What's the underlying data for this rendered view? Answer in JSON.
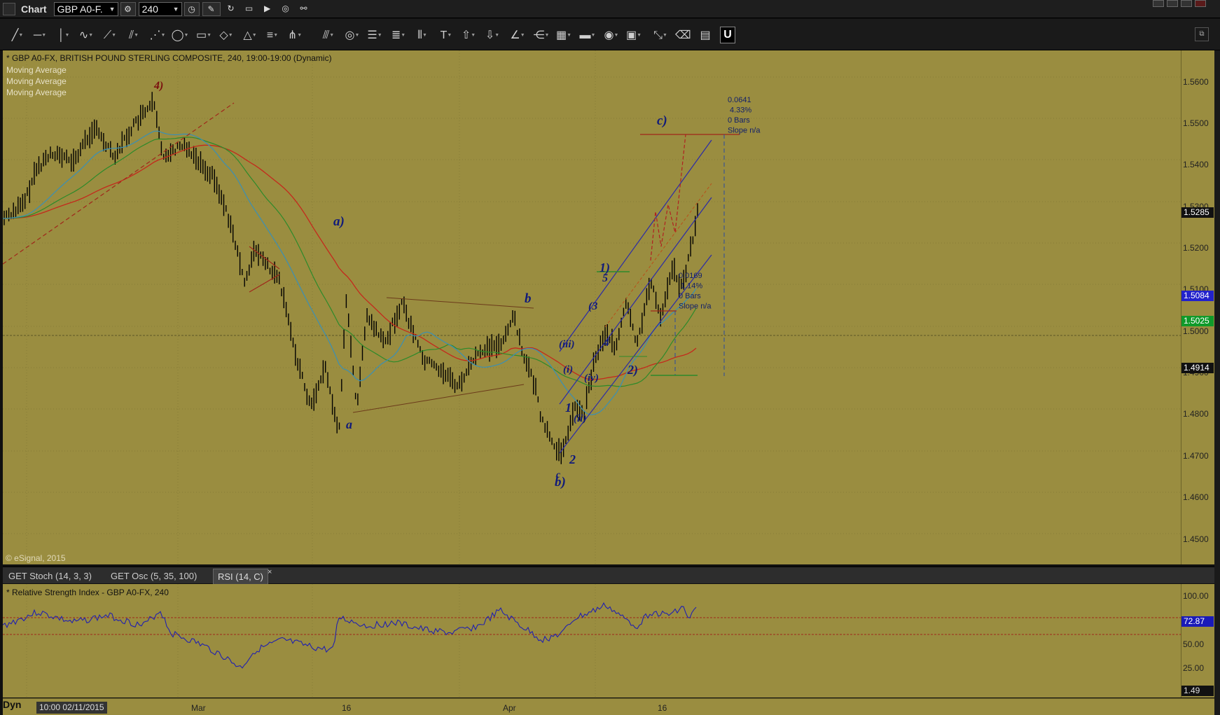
{
  "titlebar": {
    "title": "Chart",
    "symbol": "GBP A0-F.",
    "interval": "240",
    "buttons": [
      "gear-icon",
      "clock-icon",
      "pencil-icon",
      "refresh-icon",
      "card-icon",
      "play-icon",
      "alert-icon",
      "link-icon"
    ]
  },
  "toolbar": {
    "lock_label": "U"
  },
  "chart": {
    "header": "* GBP A0-FX, BRITISH POUND STERLING COMPOSITE, 240, 19:00-19:00 (Dynamic)",
    "indicators": [
      "Moving Average",
      "Moving Average",
      "Moving Average"
    ],
    "copyright": "© eSignal, 2015",
    "price_ticks": [
      "1.5600",
      "1.5500",
      "1.5400",
      "1.5300",
      "1.5200",
      "1.5100",
      "1.5000",
      "1.4900",
      "1.4800",
      "1.4700",
      "1.4600",
      "1.4500"
    ],
    "price_tags": {
      "last": "1.5285",
      "blue": "1.5084",
      "green": "1.5025",
      "red": "1.4914"
    },
    "wave_labels": {
      "four": "4)",
      "a_paren": "a)",
      "a": "a",
      "b": "b",
      "b_paren": "b)",
      "c_small": "c",
      "c_paren": "c)",
      "one_paren": "1)",
      "two_paren": "2)",
      "one": "1",
      "two": "2",
      "three": "3",
      "four_small": "4",
      "five": "5",
      "three_paren": "(3",
      "sub_i": "(i)",
      "sub_ii": "(ii)",
      "sub_iii": "(iii)",
      "sub_iv": "(iv)"
    },
    "measure_big": [
      "0.0641",
      "4.33%",
      "0 Bars",
      "Slope n/a"
    ],
    "measure_small": [
      "0.0169",
      "1.14%",
      "0 Bars",
      "Slope n/a"
    ],
    "colors": {
      "background": "#9a8d40",
      "ma_red": "#c4291c",
      "ma_green": "#2d8a2a",
      "ma_blue": "#3a8fb5",
      "wave_blue": "#101a7a",
      "wave_red": "#7a0f0f"
    }
  },
  "tabs": [
    {
      "label": "GET Stoch (14, 3, 3)"
    },
    {
      "label": "GET Osc (5, 35, 100)"
    },
    {
      "label": "RSI (14, C)"
    }
  ],
  "tab_close": "×",
  "rsi": {
    "title": "* Relative Strength Index - GBP A0-FX, 240",
    "ticks": [
      "100.00",
      "50.00",
      "25.00"
    ],
    "value_tag": "72.87",
    "bottom_value": "1.49"
  },
  "timeaxis": {
    "dyn": "Dyn",
    "readout": "10:00 02/11/2015",
    "labels": [
      "Mar",
      "16",
      "Apr",
      "16"
    ]
  }
}
